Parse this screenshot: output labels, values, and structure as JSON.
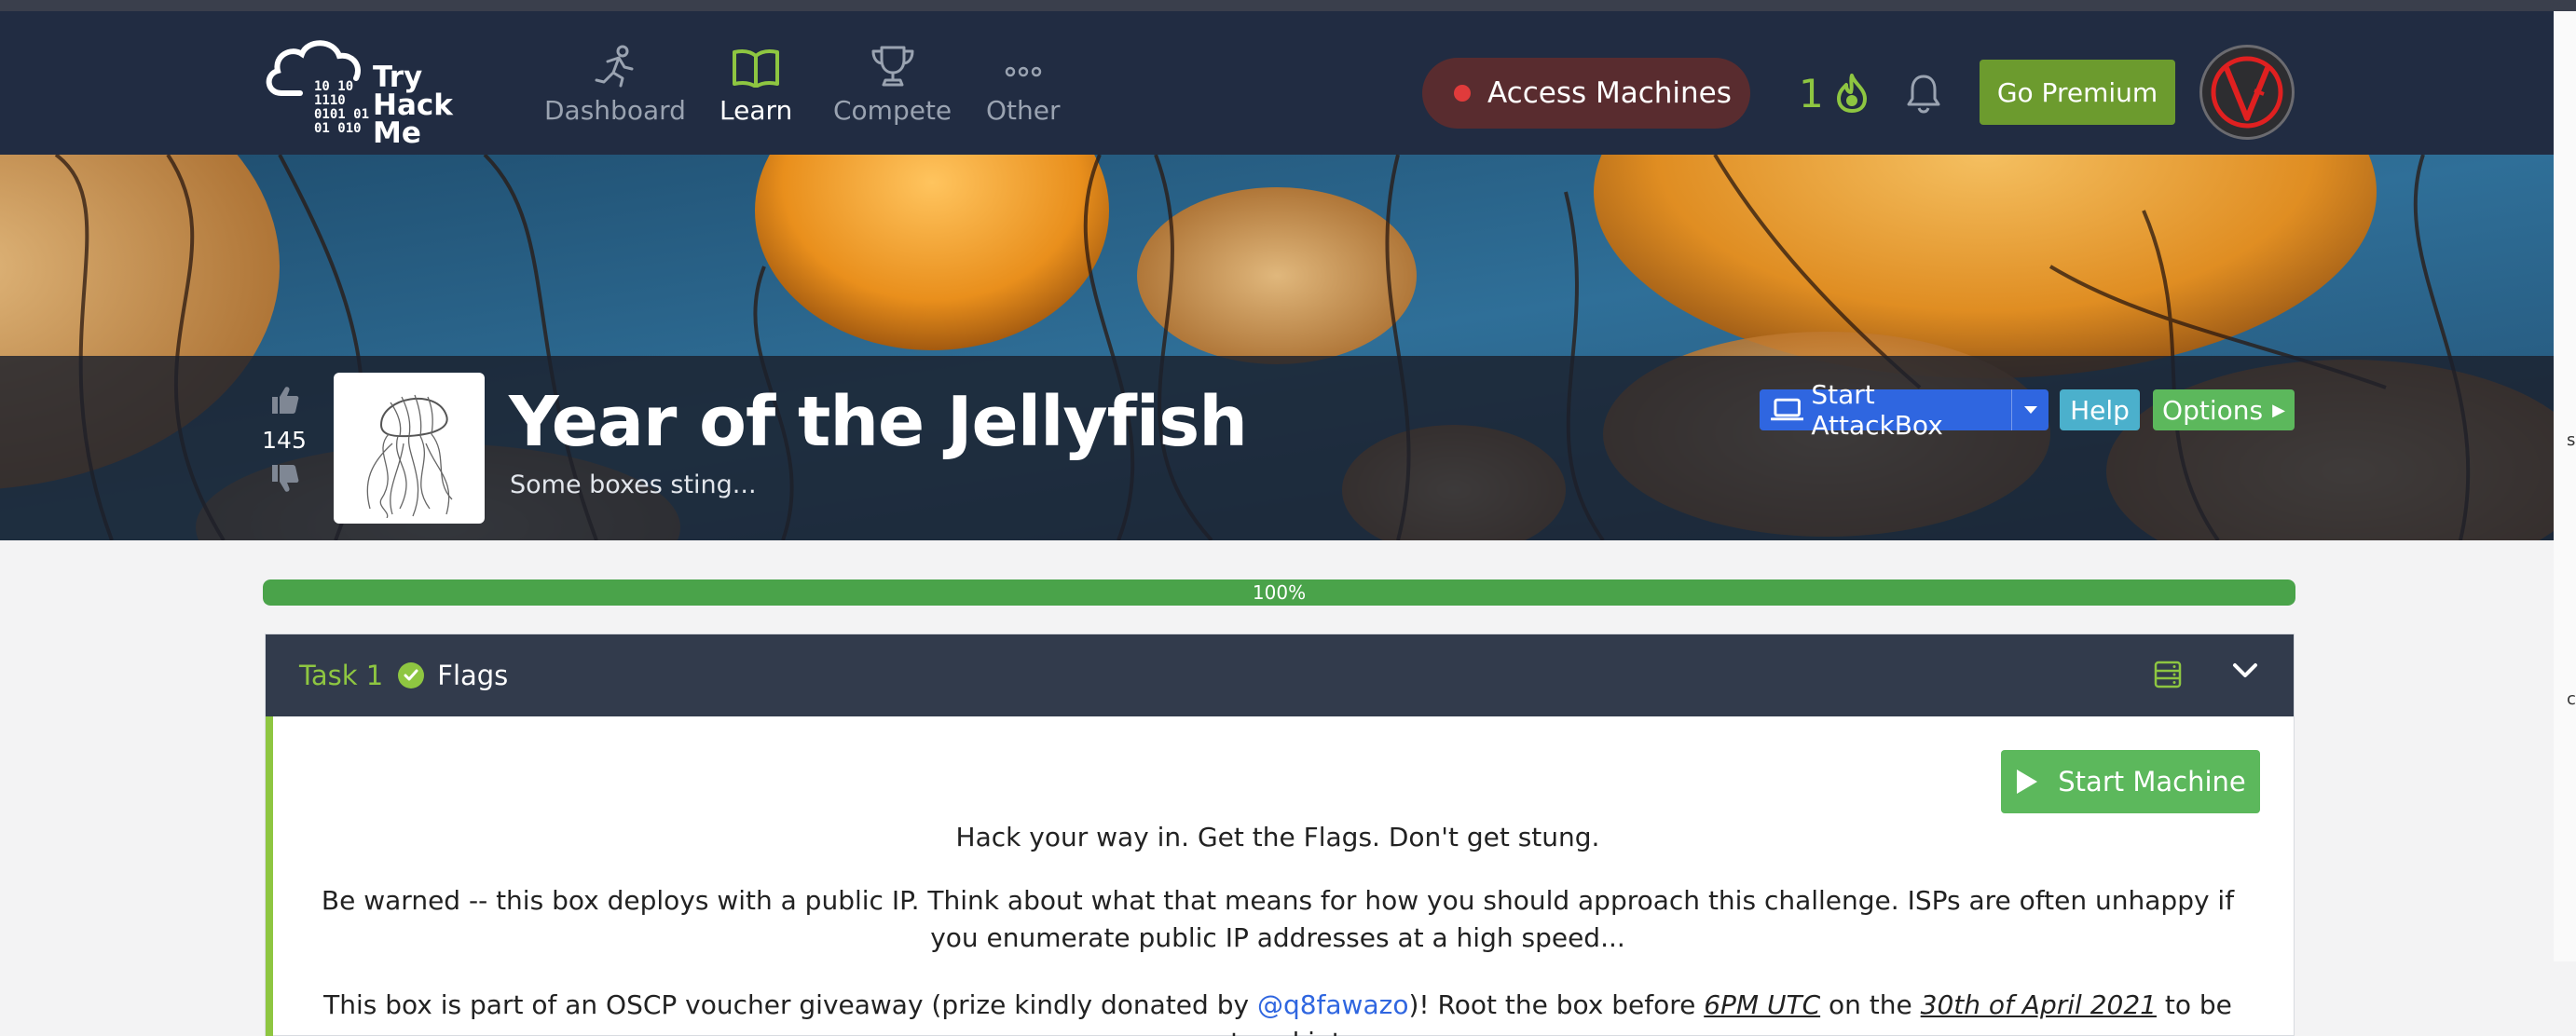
{
  "nav": {
    "logo_text": "Try\nHack\nMe",
    "logo_bits": "10 10\n1110\n0101 01\n01 010",
    "items": [
      {
        "label": "Dashboard",
        "icon": "runner-icon"
      },
      {
        "label": "Learn",
        "icon": "book-icon"
      },
      {
        "label": "Compete",
        "icon": "trophy-icon"
      },
      {
        "label": "Other",
        "icon": "more-dots-icon"
      }
    ],
    "active": "Learn",
    "access_machines": "Access Machines",
    "streak": "1",
    "go_premium": "Go Premium"
  },
  "room": {
    "votes": "145",
    "title": "Year of the Jellyfish",
    "subtitle": "Some boxes sting...",
    "start_attackbox": "Start AttackBox",
    "help": "Help",
    "options": "Options"
  },
  "progress": {
    "label": "100%",
    "fraction": 1.0
  },
  "task": {
    "number": "Task 1",
    "name": "Flags",
    "start_machine": "Start Machine",
    "line1": "Hack your way in. Get the Flags. Don't get stung.",
    "line2": "Be warned -- this box deploys with a public IP. Think about what that means for how you should approach this challenge. ISPs are often unhappy if you enumerate public IP addresses at a high speed...",
    "line3_a": "This box is part of an OSCP voucher giveaway (prize kindly donated by ",
    "line3_link": "@q8fawazo",
    "line3_b": ")! Root the box before ",
    "line3_time": "6PM UTC",
    "line3_c": " on the ",
    "line3_date": "30th of April 2021",
    "line3_d": " to be entered into"
  },
  "colors": {
    "navbar": "#212c42",
    "accent_green": "#8ec641",
    "attackbox_blue": "#2f66e0",
    "help_cyan": "#4bb0cc",
    "options_green": "#5cb85c",
    "access_bg": "#592c2f",
    "progress_fill": "#4aa34a"
  }
}
